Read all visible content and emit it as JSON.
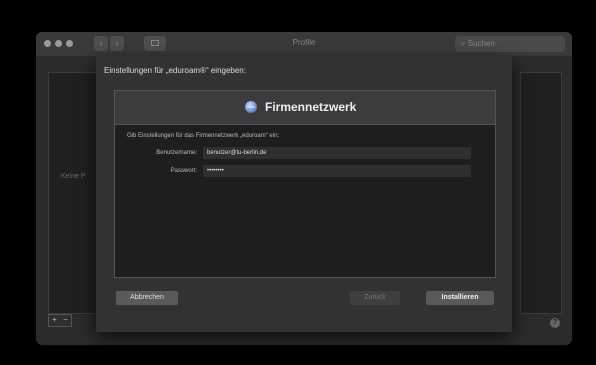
{
  "window": {
    "title": "Profile",
    "search_placeholder": "Suchen",
    "empty_label": "Keine P"
  },
  "sheet": {
    "prompt": "Einstellungen für „eduroam®“ eingeben:",
    "header_title": "Firmennetzwerk",
    "hint": "Gib Einstellungen für das Firmennetzwerk „eduroam“ ein:",
    "fields": [
      {
        "label": "Benutzername:",
        "value": "benutzer@tu-berlin.de"
      },
      {
        "label": "Passwort:",
        "value": "••••••••"
      }
    ],
    "buttons": {
      "cancel": "Abbrechen",
      "back": "Zurück",
      "install": "Installieren"
    }
  },
  "controls": {
    "add": "+",
    "remove": "−",
    "help": "?"
  }
}
